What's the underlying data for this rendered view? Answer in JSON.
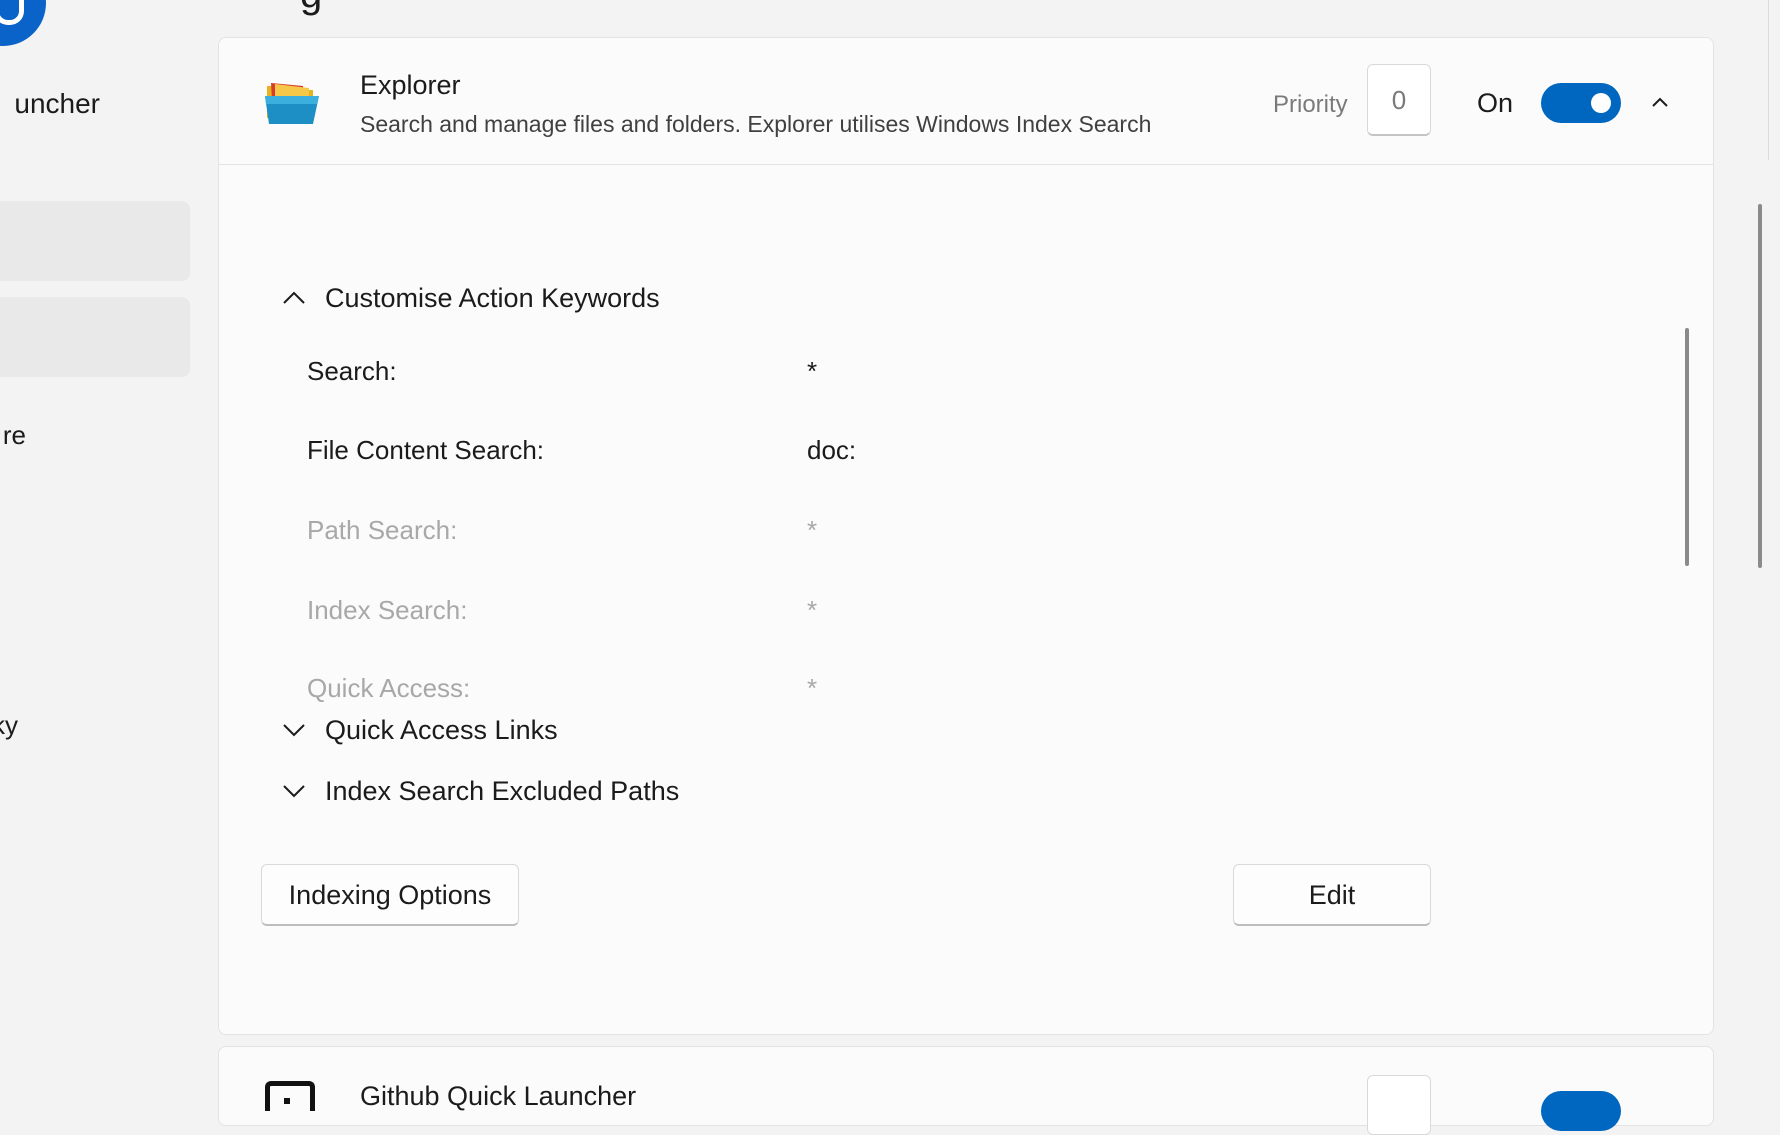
{
  "sidebar": {
    "app_name": "uncher",
    "nav_partial_a": "re",
    "nav_partial_b": "ky"
  },
  "heading_fragment": "g",
  "plugin": {
    "title": "Explorer",
    "description": "Search and manage files and folders. Explorer utilises Windows Index Search",
    "priority_label": "Priority",
    "priority_value": "0",
    "toggle_label": "On",
    "toggle_on": true
  },
  "sections": {
    "action_keywords": {
      "title": "Customise Action Keywords",
      "expanded": true,
      "rows": [
        {
          "label": "Search:",
          "value": "*",
          "enabled": true
        },
        {
          "label": "File Content Search:",
          "value": "doc:",
          "enabled": true
        },
        {
          "label": "Path Search:",
          "value": "*",
          "enabled": false
        },
        {
          "label": "Index Search:",
          "value": "*",
          "enabled": false
        },
        {
          "label": "Quick Access:",
          "value": "*",
          "enabled": false
        }
      ]
    },
    "quick_access_links": {
      "title": "Quick Access Links",
      "expanded": false
    },
    "excluded_paths": {
      "title": "Index Search Excluded Paths",
      "expanded": false
    }
  },
  "buttons": {
    "indexing_options": "Indexing Options",
    "edit": "Edit"
  },
  "next_plugin": {
    "title": "Github Quick Launcher"
  },
  "colors": {
    "accent": "#0067c0",
    "background": "#f3f3f3",
    "card": "#fbfbfb",
    "disabled_text": "#a8a8a8"
  }
}
